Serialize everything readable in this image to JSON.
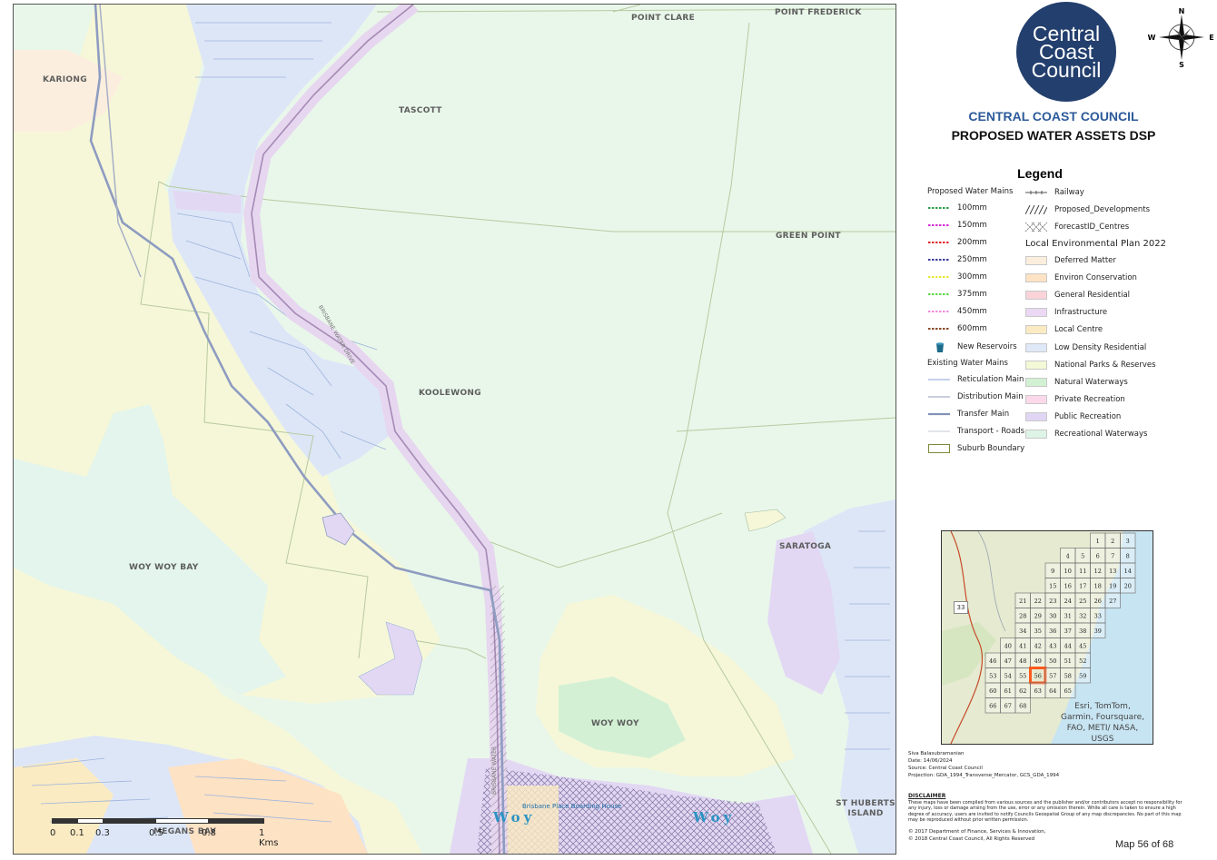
{
  "map": {
    "suburb_labels": [
      {
        "id": "point-clare",
        "text": "POINT CLARE"
      },
      {
        "id": "point-frederick",
        "text": "POINT FREDERICK"
      },
      {
        "id": "kariong",
        "text": "KARIONG"
      },
      {
        "id": "tascott",
        "text": "TASCOTT"
      },
      {
        "id": "green-point",
        "text": "GREEN POINT"
      },
      {
        "id": "koolewong",
        "text": "KOOLEWONG"
      },
      {
        "id": "saratoga",
        "text": "SARATOGA"
      },
      {
        "id": "woy-woy-bay",
        "text": "WOY WOY BAY"
      },
      {
        "id": "woy-woy",
        "text": "WOY WOY"
      },
      {
        "id": "st-huberts-island",
        "text": "ST HUBERTS ISLAND"
      },
      {
        "id": "megans-bay",
        "text": "MEGANS BAY"
      }
    ],
    "water_labels": [
      {
        "id": "woy-left",
        "text": "Woy"
      },
      {
        "id": "woy-right",
        "text": "Woy"
      }
    ],
    "poi_labels": [
      {
        "id": "boarding-house",
        "text": "Brisbane Place Boarding House"
      }
    ],
    "street_labels": [
      {
        "id": "brisbane-water-drive-upper",
        "text": "BRISBANE WATER DRIVE"
      },
      {
        "id": "brisbane-water-drive-lower",
        "text": "BRISBANE WATER"
      }
    ],
    "scale_bar": {
      "ticks": [
        "0",
        "0.1",
        "0.3",
        "0.5",
        "0.8",
        "1 Kms"
      ]
    }
  },
  "header": {
    "logo_lines": [
      "Central",
      "Coast",
      "Council"
    ],
    "compass": {
      "n": "N",
      "s": "S",
      "e": "E",
      "w": "W"
    },
    "title": "CENTRAL COAST COUNCIL",
    "subtitle": "PROPOSED WATER ASSETS DSP"
  },
  "legend": {
    "title": "Legend",
    "proposed_heading": "Proposed Water Mains",
    "proposed": [
      {
        "label": "100mm",
        "color": "#2e9e4a"
      },
      {
        "label": "150mm",
        "color": "#d62fd6"
      },
      {
        "label": "200mm",
        "color": "#e0262b"
      },
      {
        "label": "250mm",
        "color": "#3c3c9c"
      },
      {
        "label": "300mm",
        "color": "#e8e83a"
      },
      {
        "label": "375mm",
        "color": "#5ed84a"
      },
      {
        "label": "450mm",
        "color": "#f08be0"
      },
      {
        "label": "600mm",
        "color": "#8a4a28"
      }
    ],
    "reservoirs": "New Reservoirs",
    "existing_heading": "Existing Water Mains",
    "existing": [
      {
        "label": "Reticulation Main",
        "color": "#9fb8e0"
      },
      {
        "label": "Distribution Main",
        "color": "#a6b0c6"
      },
      {
        "label": "Transfer Main",
        "color": "#8292b8"
      },
      {
        "label": "Transport - Roads",
        "color": "#cfd4dc"
      }
    ],
    "suburb_boundary": "Suburb Boundary",
    "railway": "Railway",
    "proposed_developments": "Proposed_Developments",
    "forecast_centres": "ForecastID_Centres",
    "lep_heading": "Local Environmental Plan 2022",
    "lep": [
      {
        "label": "Deferred Matter",
        "color": "#fbeedd"
      },
      {
        "label": "Environ Conservation",
        "color": "#fde2c4"
      },
      {
        "label": "General Residential",
        "color": "#f9d3d8"
      },
      {
        "label": "Infrastructure",
        "color": "#ead8f4"
      },
      {
        "label": "Local Centre",
        "color": "#fbebc2"
      },
      {
        "label": "Low Density Residential",
        "color": "#dfe8f7"
      },
      {
        "label": "National Parks & Reserves",
        "color": "#f3f8d6"
      },
      {
        "label": "Natural Waterways",
        "color": "#d2f1d2"
      },
      {
        "label": "Private Recreation",
        "color": "#fbd9ea"
      },
      {
        "label": "Public Recreation",
        "color": "#e0d6f3"
      },
      {
        "label": "Recreational Waterways",
        "color": "#ddf4e6"
      }
    ]
  },
  "inset": {
    "attribution": "Esri, TomTom, Garmin, Foursquare, FAO, METI/ NASA, USGS",
    "route_marker": "33",
    "current": "56",
    "grid": [
      "1",
      "2",
      "3",
      "4",
      "5",
      "6",
      "7",
      "8",
      "9",
      "10",
      "11",
      "12",
      "13",
      "14",
      "15",
      "16",
      "17",
      "18",
      "19",
      "20",
      "21",
      "22",
      "23",
      "24",
      "25",
      "26",
      "27",
      "28",
      "29",
      "30",
      "31",
      "32",
      "33",
      "34",
      "35",
      "36",
      "37",
      "38",
      "39",
      "40",
      "41",
      "42",
      "43",
      "44",
      "45",
      "46",
      "47",
      "48",
      "49",
      "50",
      "51",
      "52",
      "53",
      "54",
      "55",
      "56",
      "57",
      "58",
      "59",
      "60",
      "61",
      "62",
      "63",
      "64",
      "65",
      "66",
      "67",
      "68"
    ]
  },
  "meta": {
    "author": "Siva Balasubramanian",
    "date": "Date: 14/06/2024",
    "source": "Source: Central Coast Council",
    "projection": "Projection: GDA_1994_Transverse_Mercator, GCS_GDA_1994",
    "disclaimer_heading": "DISCLAIMER",
    "disclaimer": "These maps have been compiled from various sources and the publisher and/or contributors accept no responsibility for any injury, loss or damage arising from the use, error or any omission therein. While all care is taken to ensure a high degree of accuracy, users are invited to notify Councils Geospatial Group of any map discrepancies. No part of this map may be reproduced without prior written permission.",
    "copyright1": "© 2017 Department of Finance, Services & Innovation,",
    "copyright2": "© 2018 Central Coast Council, All Rights Reserved",
    "map_number": "Map 56 of 68"
  }
}
